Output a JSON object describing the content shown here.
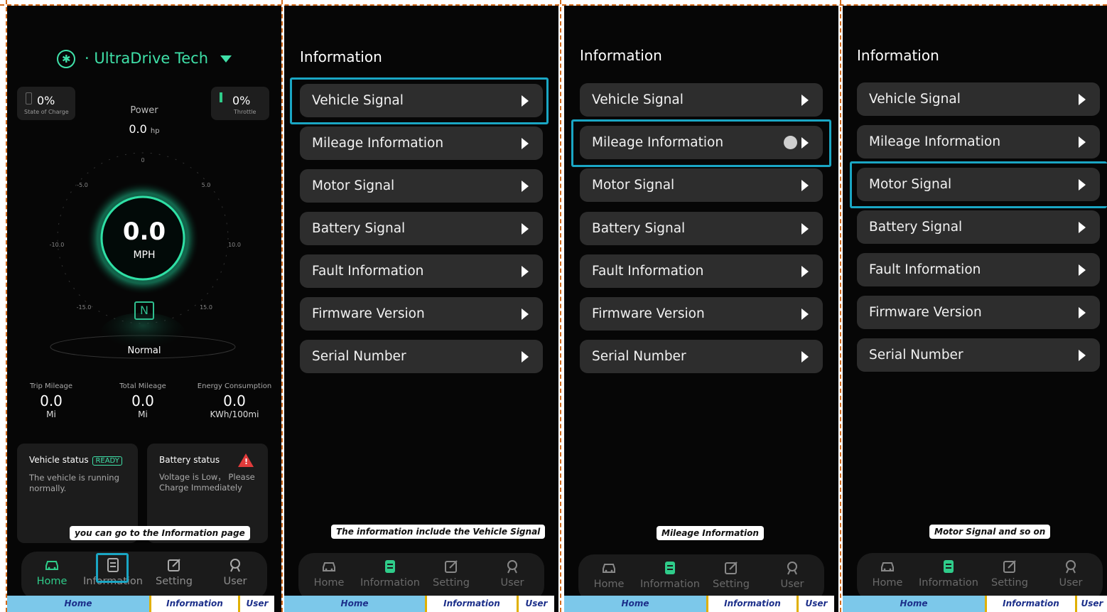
{
  "home": {
    "device_name": "UltraDrive Tech",
    "soc": {
      "value": "0%",
      "label": "State of Charge"
    },
    "throttle": {
      "value": "0%",
      "label": "Throttle"
    },
    "power": {
      "label": "Power",
      "value": "0.0",
      "unit": "hp"
    },
    "gauge_ticks": [
      "0",
      "-5.0",
      "5.0",
      "-10.0",
      "10.0",
      "-15.0",
      "15.0"
    ],
    "speed": {
      "value": "0.0",
      "unit": "MPH"
    },
    "gear": "N",
    "mode": "Normal",
    "stats": [
      {
        "title": "Trip Mileage",
        "value": "0.0",
        "unit": "Mi"
      },
      {
        "title": "Total Mileage",
        "value": "0.0",
        "unit": "Mi"
      },
      {
        "title": "Energy Consumption",
        "value": "0.0",
        "unit": "KWh/100mi"
      }
    ],
    "vehicle_status": {
      "title": "Vehicle status",
      "badge": "READY",
      "text": "The vehicle is running normally."
    },
    "battery_status": {
      "title": "Battery status",
      "text": "Voltage is Low， Please Charge Immediately"
    },
    "callout": "you can go to the Information page"
  },
  "info": {
    "title": "Information",
    "items": [
      "Vehicle Signal",
      "Mileage Information",
      "Motor Signal",
      "Battery Signal",
      "Fault Information",
      "Firmware Version",
      "Serial Number"
    ]
  },
  "callouts": [
    "The information include the Vehicle Signal",
    "Mileage Information",
    "Motor Signal and so on"
  ],
  "nav": [
    "Home",
    "Information",
    "Setting",
    "User"
  ],
  "tabs": [
    "Home",
    "Information",
    "User"
  ],
  "colors": {
    "accent": "#2fcc8a",
    "highlight": "#1aa6c4",
    "warning": "#e23b3b",
    "tab_blue": "#7cc8ea"
  }
}
